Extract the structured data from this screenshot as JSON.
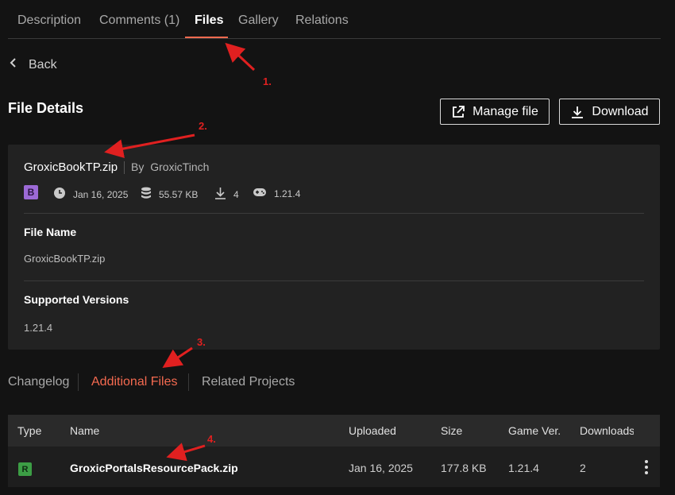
{
  "top_tabs": [
    {
      "label": "Description"
    },
    {
      "label": "Comments (1)"
    },
    {
      "label": "Files"
    },
    {
      "label": "Gallery"
    },
    {
      "label": "Relations"
    }
  ],
  "active_top_tab": "Files",
  "back_label": "Back",
  "page_title": "File Details",
  "buttons": {
    "manage": "Manage file",
    "download": "Download"
  },
  "file": {
    "name": "GroxicBookTP.zip",
    "author_prefix": "By",
    "author": "GroxicTinch",
    "release_badge": "B",
    "date": "Jan 16, 2025",
    "size": "55.57 KB",
    "downloads": "4",
    "game_version": "1.21.4"
  },
  "details": {
    "file_name_label": "File Name",
    "file_name_value": "GroxicBookTP.zip",
    "versions_label": "Supported Versions",
    "versions_value": "1.21.4"
  },
  "sub_tabs": [
    {
      "label": "Changelog"
    },
    {
      "label": "Additional Files"
    },
    {
      "label": "Related Projects"
    }
  ],
  "active_sub_tab": "Additional Files",
  "table": {
    "headers": [
      "Type",
      "Name",
      "Uploaded",
      "Size",
      "Game Ver.",
      "Downloads"
    ],
    "rows": [
      {
        "type": "R",
        "name": "GroxicPortalsResourcePack.zip",
        "uploaded": "Jan 16, 2025",
        "size": "177.8 KB",
        "game_ver": "1.21.4",
        "downloads": "2"
      }
    ]
  },
  "annotations": [
    "1.",
    "2.",
    "3.",
    "4."
  ],
  "colors": {
    "accent": "#f46a50",
    "background": "#131313",
    "card": "#222222",
    "annotation": "#e02020",
    "badge_beta": "#9c6ad6",
    "badge_release": "#3c9e45"
  },
  "icons": [
    "chevron-left-icon",
    "external-link-icon",
    "download-icon",
    "clock-icon",
    "database-icon",
    "download-arrow-icon",
    "gamepad-icon",
    "kebab-menu-icon"
  ]
}
